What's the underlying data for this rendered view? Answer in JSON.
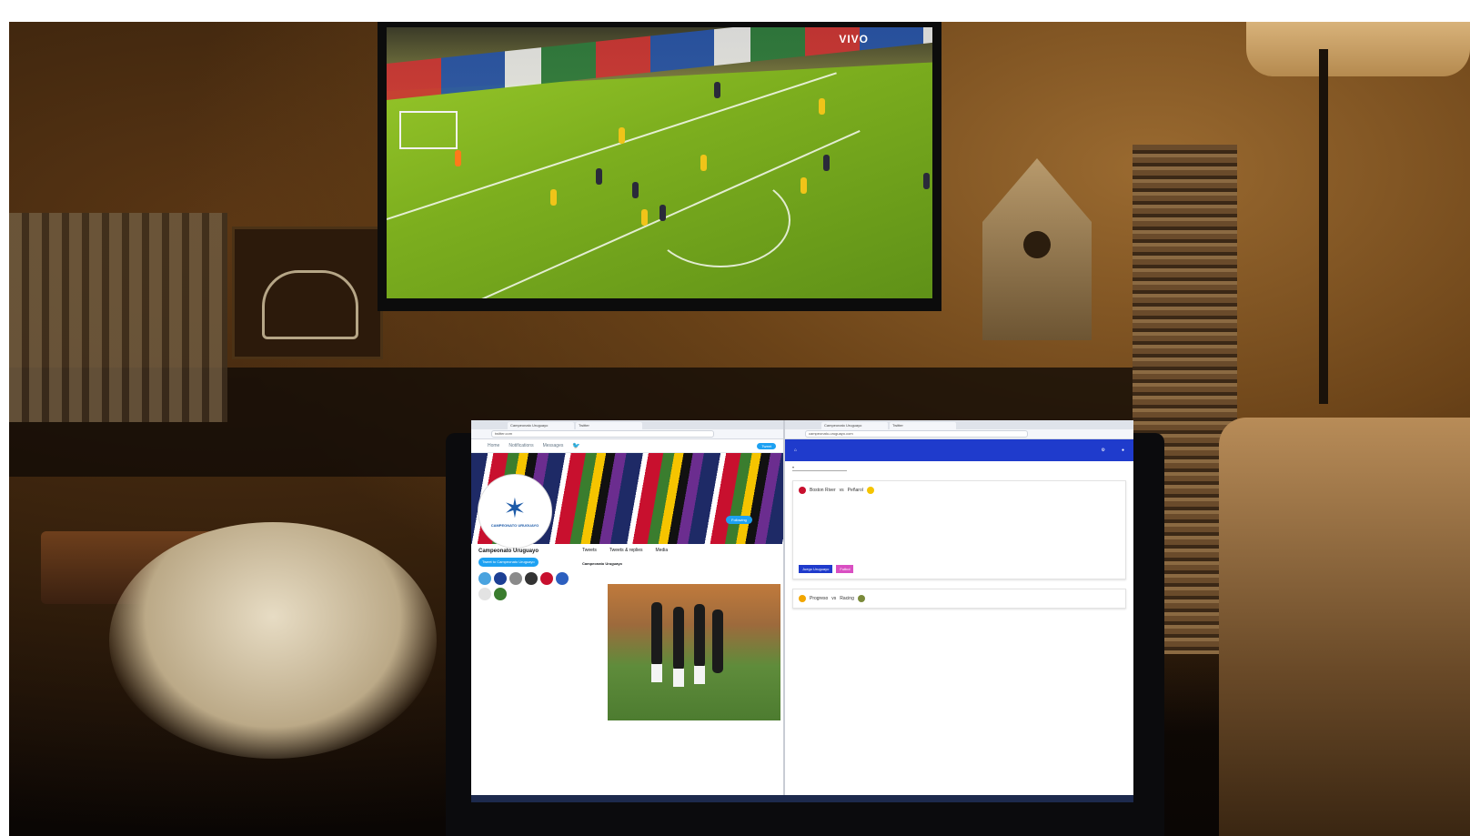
{
  "tv": {
    "overlay_label": "VIVO"
  },
  "laptop": {
    "left_window": {
      "tabs": [
        "Campeonato Uruguayo",
        "Twitter"
      ],
      "address": "twitter.com",
      "nav": [
        "Home",
        "Notifications",
        "Messages"
      ],
      "nav_button": "Tweet",
      "profile_name": "Campeonato Uruguayo",
      "avatar_caption": "CAMPEONATO URUGUAYO",
      "follow_label": "Following",
      "tweet_to_label": "Tweet to Campeonato Uruguayo",
      "feed_tabs": [
        "Tweets",
        "Tweets & replies",
        "Media"
      ],
      "tweet_author": "Campeonato Uruguayo"
    },
    "right_window": {
      "tabs": [
        "Campeonato Uruguayo",
        "Twitter"
      ],
      "address": "campeonato-uruguayo.com",
      "match_1": {
        "home": "Boston River",
        "away": "Peñarol"
      },
      "match_2": {
        "home": "Progreso",
        "away": "Racing"
      },
      "chip_blue": "Juego Uruguayo",
      "chip_pink": "Futbol"
    }
  },
  "colors": {
    "twitter_blue": "#1da1f2",
    "app_bar_blue": "#1f3bcc",
    "chip_pink": "#d94fc2",
    "pitch_green": "#7cae1e"
  }
}
